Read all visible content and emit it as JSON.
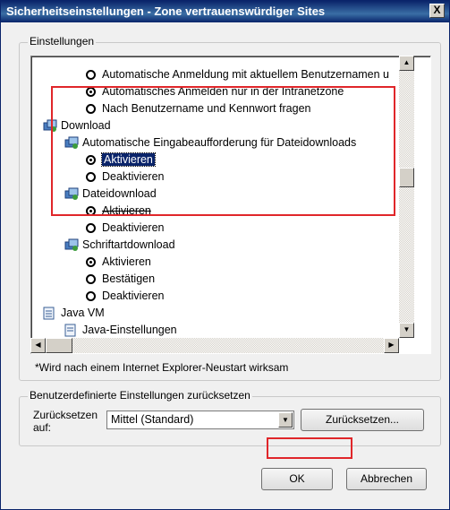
{
  "window": {
    "title": "Sicherheitseinstellungen - Zone vertrauenswürdiger Sites",
    "close_label": "X"
  },
  "settings_group": {
    "legend": "Einstellungen",
    "tree": [
      {
        "type": "radio",
        "label": "Automatische Anmeldung mit aktuellem Benutzernamen u",
        "checked": false
      },
      {
        "type": "radio",
        "label": "Automatisches Anmelden nur in der Intranetzone",
        "checked": true
      },
      {
        "type": "radio",
        "label": "Nach Benutzername und Kennwort fragen",
        "checked": false
      },
      {
        "type": "folder",
        "label": "Download"
      },
      {
        "type": "folder",
        "label": "Automatische Eingabeaufforderung für Dateidownloads"
      },
      {
        "type": "radio",
        "label": "Aktivieren",
        "checked": true
      },
      {
        "type": "radio",
        "label": "Deaktivieren",
        "checked": false
      },
      {
        "type": "folder",
        "label": "Dateidownload"
      },
      {
        "type": "radio",
        "label": "Aktivieren",
        "checked": true
      },
      {
        "type": "radio",
        "label": "Deaktivieren",
        "checked": false
      },
      {
        "type": "folder",
        "label": "Schriftartdownload"
      },
      {
        "type": "radio",
        "label": "Aktivieren",
        "checked": true
      },
      {
        "type": "radio",
        "label": "Bestätigen",
        "checked": false
      },
      {
        "type": "radio",
        "label": "Deaktivieren",
        "checked": false
      },
      {
        "type": "doc",
        "label": "Java VM"
      },
      {
        "type": "doc",
        "label": "Java-Einstellungen"
      }
    ],
    "footnote": "*Wird nach einem Internet Explorer-Neustart wirksam"
  },
  "reset_group": {
    "legend": "Benutzerdefinierte Einstellungen zurücksetzen",
    "label": "Zurücksetzen auf:",
    "select_value": "Mittel (Standard)",
    "reset_button": "Zurücksetzen..."
  },
  "buttons": {
    "ok": "OK",
    "cancel": "Abbrechen"
  },
  "colors": {
    "highlight": "#e0262a",
    "titlebar": "#0a246a",
    "selection": "#0a246a"
  }
}
